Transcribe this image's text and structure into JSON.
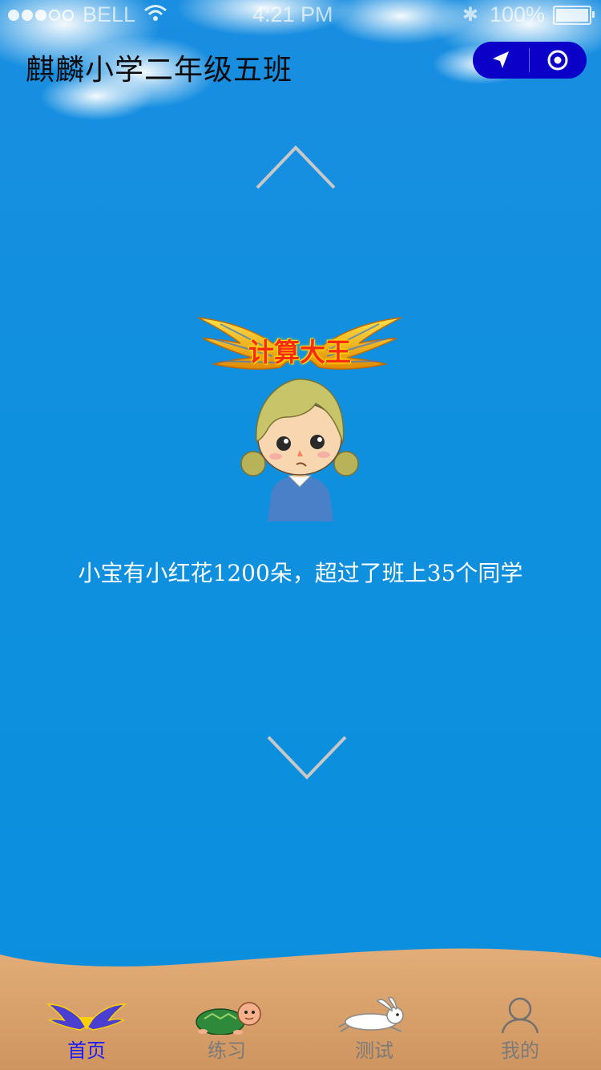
{
  "status_bar": {
    "carrier": "BELL",
    "time": "4:21 PM",
    "battery": "100%",
    "signal_bars_filled": 3,
    "signal_bars_total": 5
  },
  "header": {
    "title": "麒麟小学二年级五班",
    "capsule": {
      "left_icon": "location-arrow-icon",
      "right_icon": "target-icon"
    }
  },
  "main": {
    "badge_text": "计算大王",
    "message": "小宝有小红花1200朵，超过了班上35个同学"
  },
  "tabbar": {
    "items": [
      {
        "label": "首页",
        "icon": "winged-emblem-icon",
        "active": true
      },
      {
        "label": "练习",
        "icon": "turtle-icon",
        "active": false
      },
      {
        "label": "测试",
        "icon": "rabbit-icon",
        "active": false
      },
      {
        "label": "我的",
        "icon": "person-icon",
        "active": false
      }
    ]
  },
  "colors": {
    "background": "#0f90df",
    "capsule": "#0a00c8",
    "active_tab": "#1a1aff",
    "inactive_tab": "#7a7a7a",
    "sand": "#d8a068"
  }
}
